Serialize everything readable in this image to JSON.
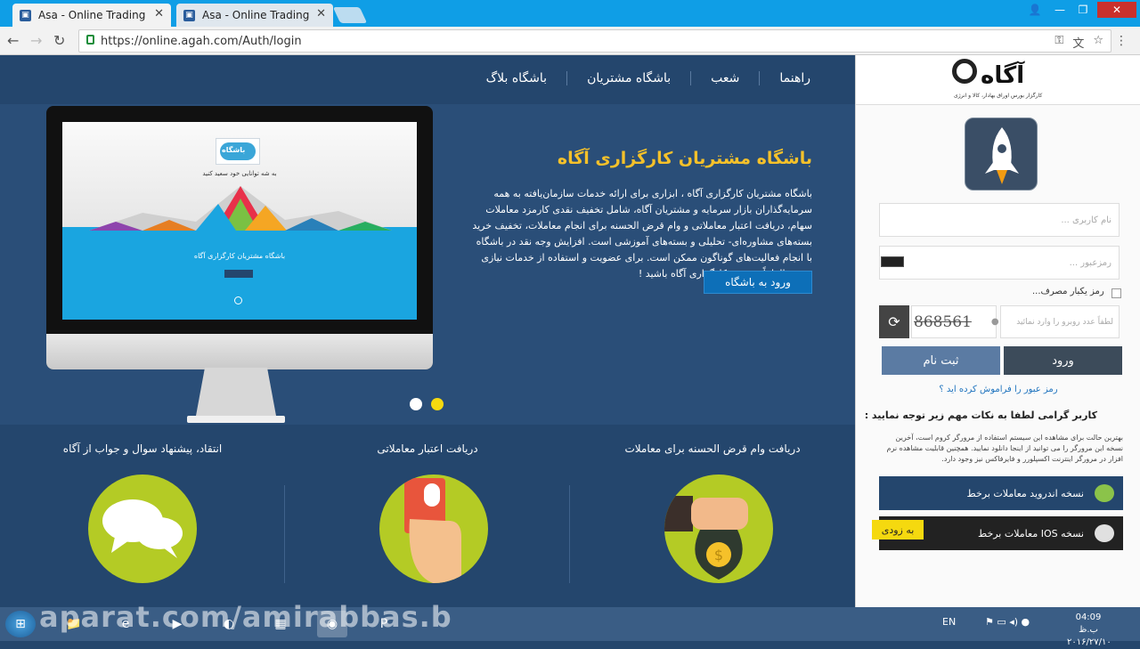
{
  "browser": {
    "tabs": [
      {
        "title": "Asa - Online Trading",
        "active": true
      },
      {
        "title": "Asa - Online Trading",
        "active": false
      }
    ],
    "url": "https://online.agah.com/Auth/login"
  },
  "main": {
    "nav": [
      "راهنما",
      "شعب",
      "باشگاه مشتریان",
      "باشگاه بلاگ"
    ],
    "hero": {
      "title": "باشگاه مشتریان کارگزاری آگاه",
      "text": "باشگاه مشتریان کارگزاری آگاه ، ابزاری برای ارائه خدمات سازمان‌یافته به همه سرمایه‌گذاران بازار سرمایه و مشتریان آگاه، شامل تخفیف نقدی کارمزد معاملات سهام، دریافت اعتبار معاملاتی و وام قرض الحسنه برای انجام معاملات، تخفیف خرید بسته‌های مشاوره‌ای- تحلیلی و بسته‌های آموزشی است. افزایش وجه نقد در باشگاه با انجام فعالیت‌های گوناگون ممکن است. برای عضویت و استفاده از خدمات نیازی نیست الزاماً مشتری کارگزاری آگاه باشید !",
      "button": "ورود به باشگاه",
      "screen_title": "باشگاه مشتریان کارگزاری آگاه",
      "screen_tagline": "به شه توانایی خود سعید کنید",
      "screen_logo": "باشگاه"
    },
    "features": [
      {
        "title": "دریافت وام قرض الحسنه برای معاملات",
        "icon": "coin-bag-icon"
      },
      {
        "title": "دریافت اعتبار معاملاتی",
        "icon": "credit-card-icon"
      },
      {
        "title": "انتقاد، پیشنهاد سوال و جواب از آگاه",
        "icon": "chat-bubbles-icon"
      }
    ]
  },
  "sidebar": {
    "brand": "آگاه",
    "brand_sub": "کارگزار بورس اوراق بهادار، کالا و انرژی",
    "username_placeholder": "نام کاربری ...",
    "password_placeholder": "رمزعبور ...",
    "otp_label": "رمز یکبار مصرف...",
    "captcha_value": "868561",
    "captcha_placeholder": "لطفاً عدد روبرو را وارد نمائید",
    "login_button": "ورود",
    "register_button": "ثبت نام",
    "forgot_link": "رمز عبور را فراموش کرده اید ؟",
    "note_title": "کاربر گرامی لطفا به نکات مهم زیر توجه نمایید :",
    "note_body": "بهترین حالت برای مشاهده این سیستم استفاده از مرورگر کروم است، آخرین نسخه این مرورگر را می توانید از اینجا دانلود نمایید. همچنین قابلیت مشاهده نرم افزار در مرورگر اینترنت اکسپلورر و فایرفاکس نیز وجود دارد.",
    "android_download": "نسخه اندروید معاملات برخط",
    "ios_download": "نسخه IOS معاملات برخط",
    "soon_badge": "به زودی"
  },
  "taskbar": {
    "language": "EN",
    "time": "04:09 ب.ظ",
    "date": "۲۰۱۶/۲۷/۱۰",
    "watermark": "aparat.com/amirabbas.b"
  },
  "colors": {
    "page_blue": "#24466d",
    "accent_yellow": "#f5c12a",
    "feature_green": "#b4cb25",
    "chrome_blue": "#0f9ee6"
  }
}
